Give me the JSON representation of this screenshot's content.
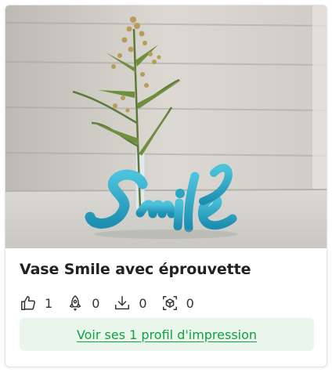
{
  "card": {
    "image_alt": "Vase Smile avec éprouvette",
    "title": "Vase Smile avec éprouvette",
    "stats": [
      {
        "icon": "thumbs-up-icon",
        "value": "1"
      },
      {
        "icon": "rocket-icon",
        "value": "0"
      },
      {
        "icon": "download-icon",
        "value": "0"
      },
      {
        "icon": "cube-icon",
        "value": "0"
      }
    ],
    "profile_button": "Voir ses 1 profil d'impression"
  },
  "colors": {
    "accent_green": "#11a142",
    "button_bg": "#eaf6ec",
    "model_blue": "#2aa6c4"
  }
}
